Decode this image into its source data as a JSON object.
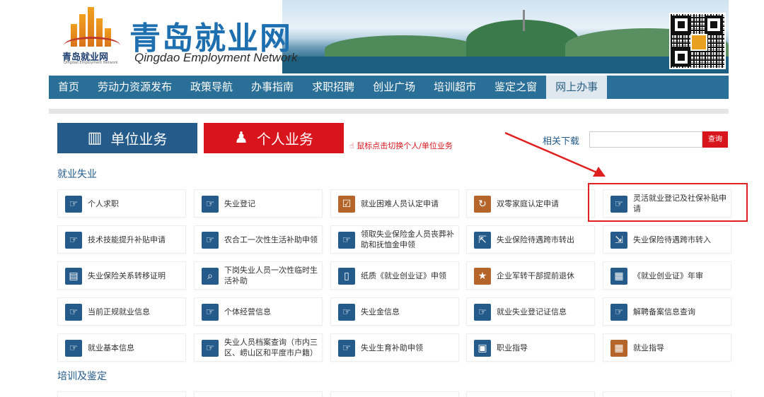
{
  "header": {
    "title": "青岛就业网",
    "subtitle": "Qingdao Employment Network",
    "logo_text": "青岛就业网",
    "logo_tiny": "Qingdao Employment Network"
  },
  "nav": {
    "items": [
      {
        "label": "首页"
      },
      {
        "label": "劳动力资源发布"
      },
      {
        "label": "政策导航"
      },
      {
        "label": "办事指南"
      },
      {
        "label": "求职招聘"
      },
      {
        "label": "创业广场"
      },
      {
        "label": "培训超市"
      },
      {
        "label": "鉴定之窗"
      },
      {
        "label": "网上办事",
        "active": true
      }
    ]
  },
  "tabs": {
    "unit": "单位业务",
    "personal": "个人业务",
    "hint": "鼠标点击切换个人/单位业务"
  },
  "search": {
    "download_label": "相关下载",
    "value": "",
    "button": "查询"
  },
  "sections": {
    "employment": "就业失业",
    "training": "培训及鉴定"
  },
  "cards": [
    [
      "个人求职",
      "失业登记",
      "就业困难人员认定申请",
      "双零家庭认定申请",
      "灵活就业登记及社保补贴申请"
    ],
    [
      "技术技能提升补贴申请",
      "农合工一次性生活补助申领",
      "领取失业保险金人员丧葬补助和抚恤金申领",
      "失业保险待遇跨市转出",
      "失业保险待遇跨市转入"
    ],
    [
      "失业保险关系转移证明",
      "下岗失业人员一次性临时生活补助",
      "纸质《就业创业证》申领",
      "企业军转干部提前退休",
      "《就业创业证》年审"
    ],
    [
      "当前正规就业信息",
      "个体经营信息",
      "失业金信息",
      "就业失业登记证信息",
      "解聘备案信息查询"
    ],
    [
      "就业基本信息",
      "失业人员档案查询（市内三区、崂山区和平度市户籍）",
      "失业生育补助申领",
      "职业指导",
      "就业指导"
    ]
  ],
  "colors": {
    "nav_bg": "#2a6f98",
    "unit_tab": "#245b8a",
    "personal_tab": "#d8141d",
    "highlight": "#e02020"
  }
}
